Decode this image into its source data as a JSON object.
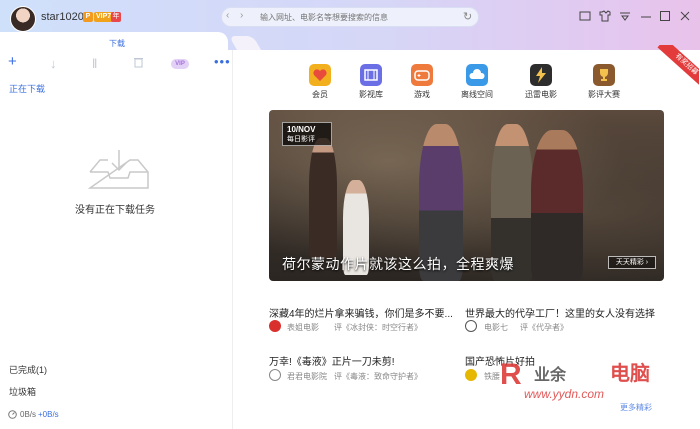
{
  "user": {
    "name": "star1020",
    "badge_p": "P",
    "badge_vip": "VIP7",
    "badge_year": "年"
  },
  "nav": {
    "back": "‹",
    "forward": "›",
    "url_placeholder": "输入网址、电影名等想要搜索的信息",
    "refresh": "↻"
  },
  "window_controls": [
    "□",
    "👕",
    "▽",
    "−",
    "□",
    "✕"
  ],
  "tab": {
    "title": "下载"
  },
  "toolbar": {
    "add": "+",
    "download": "↓",
    "pause": "‖",
    "delete": "🗑",
    "vip": "VIP",
    "more": "•••"
  },
  "left": {
    "downloading_label": "正在下载",
    "empty_text": "没有正在下载任务",
    "completed_label": "已完成(1)",
    "trash_label": "垃圾箱",
    "speed_down": "0B/s",
    "speed_up": "+0B/s"
  },
  "ribbon": {
    "text": "有奖招募"
  },
  "categories": [
    {
      "label": "会员",
      "color": "#e84a3c",
      "icon": "heart-icon"
    },
    {
      "label": "影视库",
      "color": "#6b6fe6",
      "icon": "film-icon"
    },
    {
      "label": "游戏",
      "color": "#ef7a3d",
      "icon": "gamepad-icon"
    },
    {
      "label": "离线空间",
      "color": "#3b9ae8",
      "icon": "cloud-icon"
    },
    {
      "label": "迅雷电影",
      "color": "#2d2d2d",
      "icon": "thunder-icon"
    },
    {
      "label": "影评大赛",
      "color": "#8a5a2e",
      "icon": "trophy-icon"
    }
  ],
  "banner": {
    "date": "10/NOV",
    "daily": "每日影评",
    "caption": "荷尔蒙动作片就该这么拍，全程爽爆",
    "more_button": "天天精彩 ›"
  },
  "articles": [
    {
      "title": "深藏4年的烂片拿来骗钱，你们是多不要...",
      "source": "表姐电影",
      "review": "评《冰封侠：时空行者》",
      "icon_color": "#d9302e"
    },
    {
      "title": "世界最大的代孕工厂！这里的女人没有选择",
      "source": "电影七",
      "review": "评《代孕者》",
      "icon_color": "#555555"
    },
    {
      "title": "万幸!《毒液》正片一刀未剪!",
      "source": "君君电影院",
      "review": "评《毒液：致命守护者》",
      "icon_color": "#888888"
    },
    {
      "title": "国产恐怖片好拍",
      "source": "铁腰",
      "review": "",
      "icon_color": "#e6b800"
    }
  ],
  "watermark": {
    "brand": "电脑",
    "prefix": "业余",
    "url": "www.yydn.com",
    "slogan": "更多精彩"
  }
}
